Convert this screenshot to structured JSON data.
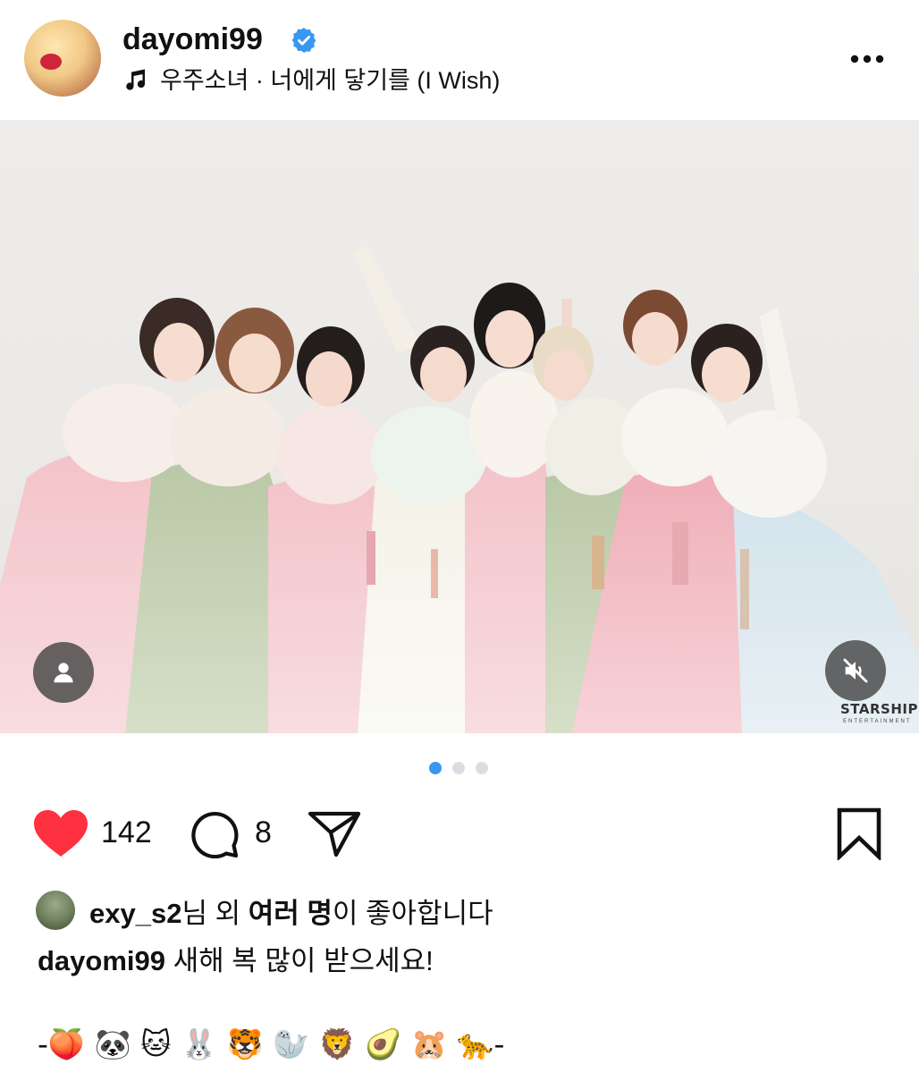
{
  "header": {
    "username": "dayomi99",
    "music_track": "우주소녀 · 너에게 닿기를 (I Wish)"
  },
  "media": {
    "watermark": "STARSHIP",
    "watermark_sub": "ENTERTAINMENT",
    "carousel_total": 3,
    "carousel_active": 1
  },
  "actions": {
    "likes_count": "142",
    "comments_count": "8"
  },
  "liked_by": {
    "user": "exy_s2",
    "suffix_1": "님 외 ",
    "others": "여러 명",
    "suffix_2": "이 좋아합니다"
  },
  "caption": {
    "username": "dayomi99",
    "text": " 새해 복 많이 받으세요!"
  },
  "emoji_line": "-🍑 🐼 🐱 🐰 🐯 🦭 🦁 🥑 🐹 🐆-",
  "colors": {
    "like_red": "#ff3040",
    "verified_blue": "#3897f0",
    "active_dot": "#3897f0"
  },
  "icons": [
    "music-note-icon",
    "verified-badge-icon",
    "more-options-icon",
    "user-tag-icon",
    "mute-icon",
    "heart-icon",
    "comment-icon",
    "share-icon",
    "bookmark-icon"
  ]
}
